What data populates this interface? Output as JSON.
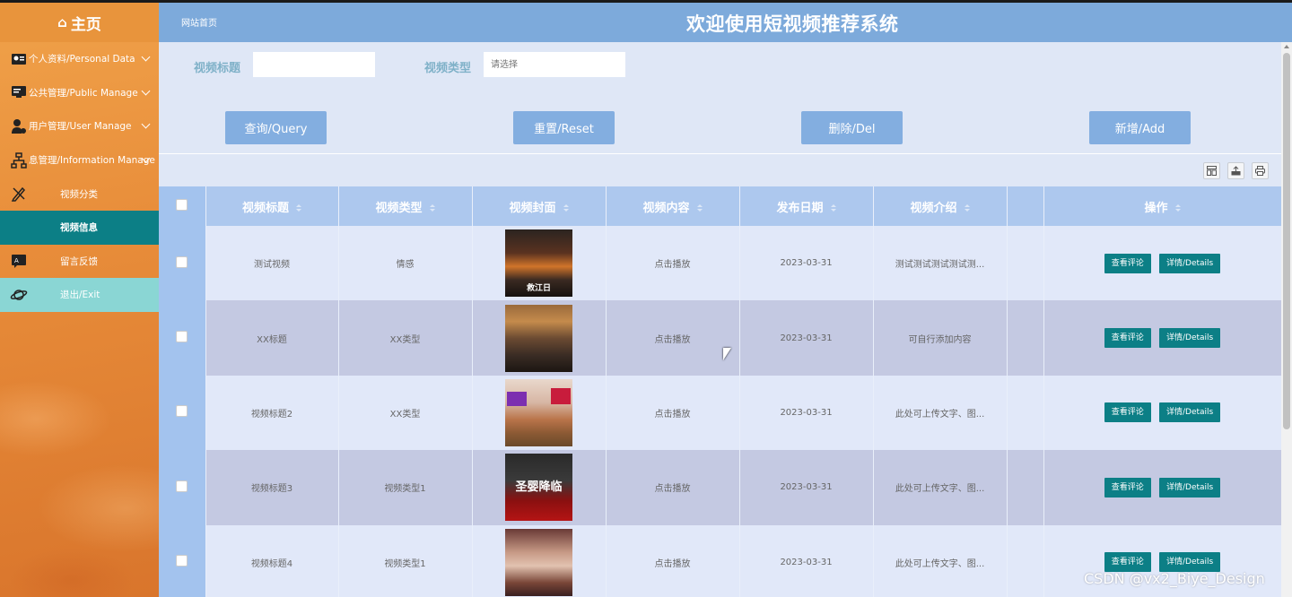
{
  "sidebar": {
    "brand": "主页",
    "items": [
      {
        "label": "个人资料/Personal Data",
        "icon": "user-card-icon",
        "has_chevron": true
      },
      {
        "label": "公共管理/Public Manage",
        "icon": "monitor-icon",
        "has_chevron": true
      },
      {
        "label": "用户管理/User Manage",
        "icon": "user-gear-icon",
        "has_chevron": true
      },
      {
        "label": "息管理/Information Manage",
        "icon": "org-chart-icon",
        "has_chevron": true
      },
      {
        "label": "视频分类",
        "icon": "pencil-ruler-icon",
        "has_chevron": false
      },
      {
        "label": "视频信息",
        "icon": "",
        "has_chevron": false
      },
      {
        "label": "留言反馈",
        "icon": "translate-icon",
        "has_chevron": false
      },
      {
        "label": "退出/Exit",
        "icon": "planet-icon",
        "has_chevron": false
      }
    ]
  },
  "header": {
    "breadcrumb": "网站首页",
    "title": "欢迎使用短视频推荐系统"
  },
  "search": {
    "title_label": "视频标题",
    "title_value": "",
    "type_label": "视频类型",
    "type_placeholder": "请选择",
    "buttons": {
      "query": "查询/Query",
      "reset": "重置/Reset",
      "delete": "删除/Del",
      "add": "新增/Add"
    }
  },
  "toolbar": {
    "icons": [
      "columns-icon",
      "export-icon",
      "print-icon"
    ]
  },
  "table": {
    "headers": [
      "视频标题",
      "视频类型",
      "视频封面",
      "视频内容",
      "发布日期",
      "视频介绍",
      "",
      "操作"
    ],
    "rows": [
      {
        "title": "测试视频",
        "type": "情感",
        "cover": "movie-poster-disaster",
        "content": "点击播放",
        "date": "2023-03-31",
        "intro": "测试测试测试测试测...",
        "cover_text": "救江日"
      },
      {
        "title": "XX标题",
        "type": "XX类型",
        "cover": "movie-poster-city",
        "content": "点击播放",
        "date": "2023-03-31",
        "intro": "可自行添加内容",
        "cover_text": ""
      },
      {
        "title": "视频标题2",
        "type": "XX类型",
        "cover": "food-vlog-cover",
        "content": "点击播放",
        "date": "2023-03-31",
        "intro": "此处可上传文字、图...",
        "cover_text": ""
      },
      {
        "title": "视频标题3",
        "type": "视频类型1",
        "cover": "football-cover",
        "content": "点击播放",
        "date": "2023-03-31",
        "intro": "此处可上传文字、图...",
        "cover_text": "圣婴降临"
      },
      {
        "title": "视频标题4",
        "type": "视频类型1",
        "cover": "portrait-cover",
        "content": "点击播放",
        "date": "2023-03-31",
        "intro": "此处可上传文字、图...",
        "cover_text": ""
      }
    ],
    "actions": {
      "comments": "查看评论",
      "details": "详情/Details"
    }
  },
  "watermark": "CSDN @vx2_Biye_Design",
  "colors": {
    "sidebar_orange": "#e8943c",
    "active_teal": "#0c7f86",
    "header_blue": "#7daadb",
    "button_blue": "#83aee0"
  }
}
